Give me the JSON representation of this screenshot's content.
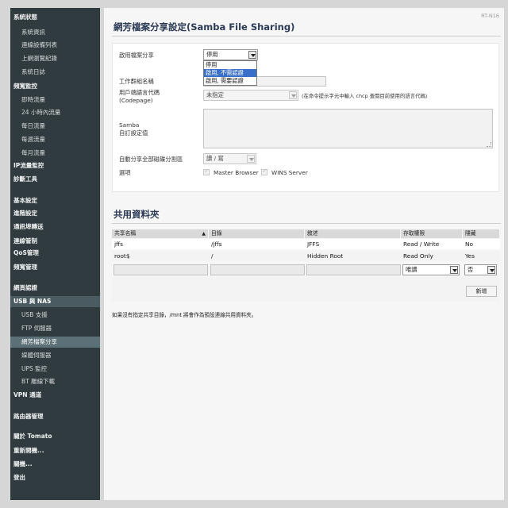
{
  "model": "RT-N16",
  "sidebar": {
    "items": [
      {
        "label": "系統狀態",
        "level": 1
      },
      {
        "label": "系統資訊",
        "level": 2
      },
      {
        "label": "連線設備列表",
        "level": 2
      },
      {
        "label": "上網瀏覽紀錄",
        "level": 2
      },
      {
        "label": "系統日誌",
        "level": 2
      },
      {
        "label": "頻寬監控",
        "level": 1
      },
      {
        "label": "即時流量",
        "level": 2
      },
      {
        "label": "24 小時內流量",
        "level": 2
      },
      {
        "label": "每日流量",
        "level": 2
      },
      {
        "label": "每週流量",
        "level": 2
      },
      {
        "label": "每月流量",
        "level": 2
      },
      {
        "label": "IP流量監控",
        "level": 1
      },
      {
        "label": "診斷工具",
        "level": 1
      },
      {
        "label": "基本設定",
        "level": 1
      },
      {
        "label": "進階設定",
        "level": 1
      },
      {
        "label": "通訊埠轉送",
        "level": 1
      },
      {
        "label": "連線管制",
        "level": 1
      },
      {
        "label": "QoS管理",
        "level": 1
      },
      {
        "label": "頻寬管理",
        "level": 1
      },
      {
        "label": "網頁認證",
        "level": 1
      },
      {
        "label": "USB 與 NAS",
        "level": 1
      },
      {
        "label": "USB 支援",
        "level": 2
      },
      {
        "label": "FTP 伺服器",
        "level": 2
      },
      {
        "label": "網芳檔案分享",
        "level": 2
      },
      {
        "label": "媒體伺服器",
        "level": 2
      },
      {
        "label": "UPS 監控",
        "level": 2
      },
      {
        "label": "BT 離線下載",
        "level": 2
      },
      {
        "label": "VPN 通道",
        "level": 1
      },
      {
        "label": "路由器管理",
        "level": 1
      },
      {
        "label": "關於 Tomato",
        "level": 1
      },
      {
        "label": "重新開機...",
        "level": 1
      },
      {
        "label": "關機...",
        "level": 1
      },
      {
        "label": "登出",
        "level": 1
      }
    ]
  },
  "settings": {
    "title": "網芳檔案分享設定(Samba File Sharing)",
    "enable_label": "啟用檔案分享",
    "enable_value": "停用",
    "enable_options": [
      "停用",
      "啟用, 不需認證",
      "啟用, 需要認證"
    ],
    "enable_highlighted": 1,
    "workgroup_label": "工作群組名稱",
    "codepage_label_1": "用戶端語言代碼",
    "codepage_label_2": "(Codepage)",
    "codepage_value": "未指定",
    "codepage_hint": "(在命令提示字元中輸入 chcp 查閱目前使用的語言代碼)",
    "custom_label_1": "Samba",
    "custom_label_2": "自訂設定值",
    "autoshare_label": "自動分享全部磁碟分割區",
    "autoshare_value": "讀 / 寫",
    "options_label": "選項",
    "master_browser_label": "Master Browser",
    "wins_server_label": "WINS Server"
  },
  "shares": {
    "title": "共用資料夾",
    "columns": [
      "共享名稱",
      "目錄",
      "敘述",
      "存取權限",
      "隱藏"
    ],
    "rows": [
      {
        "name": "jffs",
        "dir": "/jffs",
        "desc": "JFFS",
        "access": "Read / Write",
        "hidden": "No"
      },
      {
        "name": "root$",
        "dir": "/",
        "desc": "Hidden Root",
        "access": "Read Only",
        "hidden": "Yes"
      }
    ],
    "new_access": "唯讀",
    "new_hidden": "否",
    "add_label": "新增",
    "footnote": "如果沒有指定共享目錄，/mnt 將會作為預設連線共用資料夾。"
  },
  "colors": {
    "sidebar_bg": "#2f3b3f",
    "title_color": "#2b3a55",
    "highlight": "#3a6fc9"
  }
}
